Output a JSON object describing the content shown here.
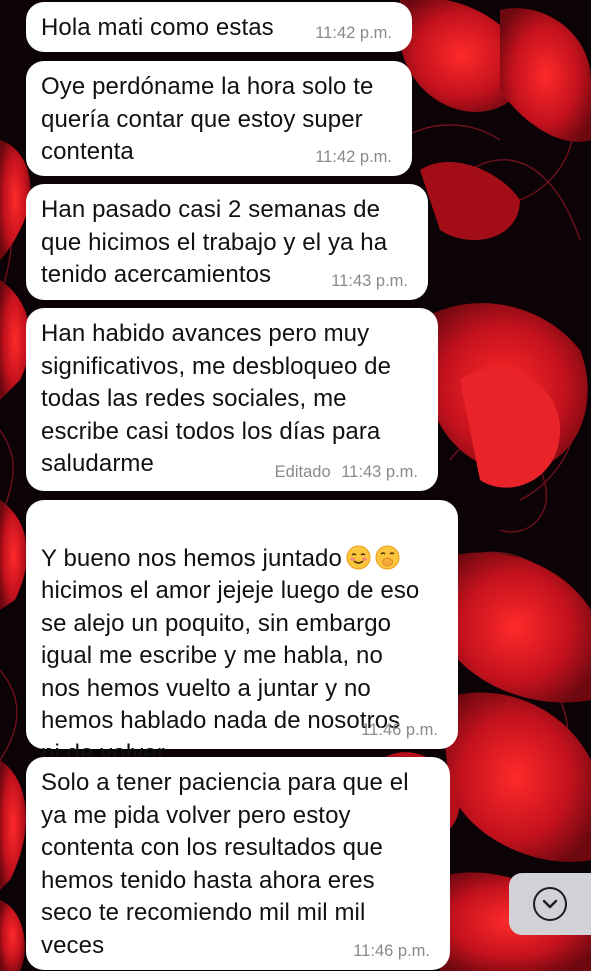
{
  "messages": [
    {
      "text": "Hola mati como estas",
      "time": "11:42",
      "ampm": "p.m.",
      "edited": ""
    },
    {
      "text": "Oye perdóname la hora solo te\nquería contar que estoy super\ncontenta",
      "time": "11:42",
      "ampm": "p.m.",
      "edited": ""
    },
    {
      "text": "Han pasado casi 2 semanas de\nque hicimos el trabajo y el ya ha\ntenido acercamientos",
      "time": "11:43",
      "ampm": "p.m.",
      "edited": ""
    },
    {
      "text": "Han habido avances pero muy\nsignificativos, me desbloqueo de\ntodas las redes sociales, me\nescribe casi todos los días para\nsaludarme",
      "time": "11:43",
      "ampm": "p.m.",
      "edited": "Editado"
    },
    {
      "text_first": "Y bueno nos hemos juntado",
      "text": "\nhicimos el amor jejeje luego de eso\nse alejo un poquito, sin embargo\nigual me escribe y me habla, no\nnos hemos vuelto a juntar y no\nhemos hablado nada de nosotros\nni de volver",
      "emojis": [
        "smiling-face-with-smiling-eyes",
        "hushed-face-with-hand-over-mouth"
      ],
      "time": "11:46",
      "ampm": "p.m.",
      "edited": ""
    },
    {
      "text": "Solo a tener paciencia para que el\nya me pida volver pero estoy\ncontenta con los resultados que\nhemos tenido hasta ahora eres\nseco te recomiendo mil mil mil\nveces",
      "time": "11:46",
      "ampm": "p.m.",
      "edited": ""
    }
  ],
  "scroll_button": {
    "icon": "chevron-down-circle-icon"
  },
  "colors": {
    "bubble": "#ffffff",
    "timestamp": "#8a8a8e",
    "wallpaper_base": "#0b0306",
    "flower_red": "#c4121d",
    "scroll_button_bg": "#d1d1d6"
  }
}
